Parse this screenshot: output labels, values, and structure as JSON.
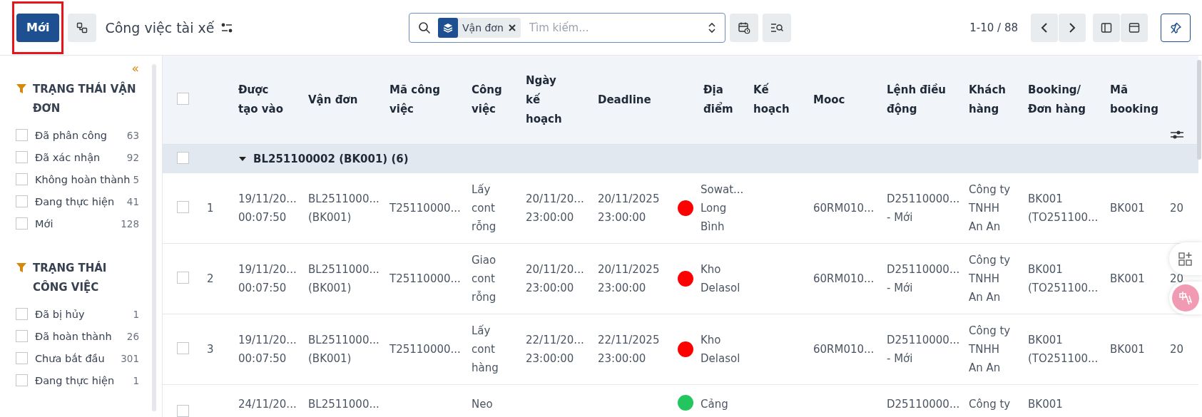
{
  "toolbar": {
    "new_button": {
      "label": "Mới",
      "highlighted": true
    },
    "title": "Công việc tài xế"
  },
  "search": {
    "facet": "Vận đơn",
    "placeholder": "Tìm kiếm..."
  },
  "pager": "1-10 / 88",
  "sidebar": {
    "collapse": "«",
    "groups": [
      {
        "title": "TRẠNG THÁI VẬN ĐƠN",
        "items": [
          {
            "label": "Đã phân công",
            "count": "63",
            "checked": false
          },
          {
            "label": "Đã xác nhận",
            "count": "92",
            "checked": false
          },
          {
            "label": "Không hoàn thành",
            "count": "5",
            "checked": false
          },
          {
            "label": "Đang thực hiện",
            "count": "41",
            "checked": false
          },
          {
            "label": "Mới",
            "count": "128",
            "checked": false
          }
        ]
      },
      {
        "title": "TRẠNG THÁI CÔNG VIỆC",
        "items": [
          {
            "label": "Đã bị hủy",
            "count": "1",
            "checked": false
          },
          {
            "label": "Đã hoàn thành",
            "count": "26",
            "checked": false
          },
          {
            "label": "Chưa bắt đầu",
            "count": "301",
            "checked": false
          },
          {
            "label": "Đang thực hiện",
            "count": "1",
            "checked": false
          }
        ]
      }
    ]
  },
  "table": {
    "all_checked": false,
    "columns": [
      "Được\ntạo vào",
      "Vận đơn",
      "Mã công\nviệc",
      "Công\nviệc",
      "Ngày\nkế\nhoạch",
      "Deadline",
      "Địa\nđiểm",
      "Kế\nhoạch",
      "Mooc",
      "Lệnh điều\nđộng",
      "Khách\nhàng",
      "Booking/\nĐơn hàng",
      "Mã\nbooking"
    ],
    "group": {
      "label": "BL251100002 (BK001) (6)",
      "expanded": true,
      "checked": false
    },
    "rows": [
      {
        "checked": false,
        "number": "1",
        "created": "19/11/20...\n00:07:50",
        "bill": "BL2511000...\n(BK001)",
        "job_code": "T25110000...",
        "job": "Lấy\ncont\nrỗng",
        "planned": "20/11/20...\n23:00:00",
        "deadline": "20/11/2025\n23:00:00",
        "color": "#ff0000",
        "location": "Sowat...\nLong\nBình",
        "mooc": "60RM010...",
        "order": "D25110000...\n- Mới",
        "customer": "Công ty\nTNHH\nAn An",
        "booking": "BK001\n(TO251100...",
        "booking_code": "BK001",
        "column_14": "20"
      },
      {
        "checked": false,
        "number": "2",
        "created": "19/11/20...\n00:07:50",
        "bill": "BL2511000...\n(BK001)",
        "job_code": "T25110000...",
        "job": "Giao\ncont\nrỗng",
        "planned": "20/11/20...\n23:00:00",
        "deadline": "20/11/2025\n23:00:00",
        "color": "#ff0000",
        "location": "Kho\nDelasol",
        "mooc": "60RM010...",
        "order": "D25110000...\n- Mới",
        "customer": "Công ty\nTNHH\nAn An",
        "booking": "BK001\n(TO251100...",
        "booking_code": "BK001",
        "column_14": "20"
      },
      {
        "checked": false,
        "number": "3",
        "created": "19/11/20...\n00:07:50",
        "bill": "BL2511000...\n(BK001)",
        "job_code": "T25110000...",
        "job": "Lấy\ncont\nhàng",
        "planned": "22/11/20...\n23:00:00",
        "deadline": "22/11/2025\n23:00:00",
        "color": "#ff0000",
        "location": "Kho\nDelasol",
        "mooc": "60RM010...",
        "order": "D25110000...\n- Mới",
        "customer": "Công ty\nTNHH\nAn An",
        "booking": "BK001\n(TO251100...",
        "booking_code": "BK001",
        "column_14": "20"
      },
      {
        "checked": false,
        "created": "24/11/20...",
        "bill": "BL2511000...",
        "job": "Neo",
        "color": "#22c55e",
        "location": "Cảng",
        "order": "D25110000...",
        "customer": "Công ty",
        "booking": "BK001"
      }
    ]
  }
}
